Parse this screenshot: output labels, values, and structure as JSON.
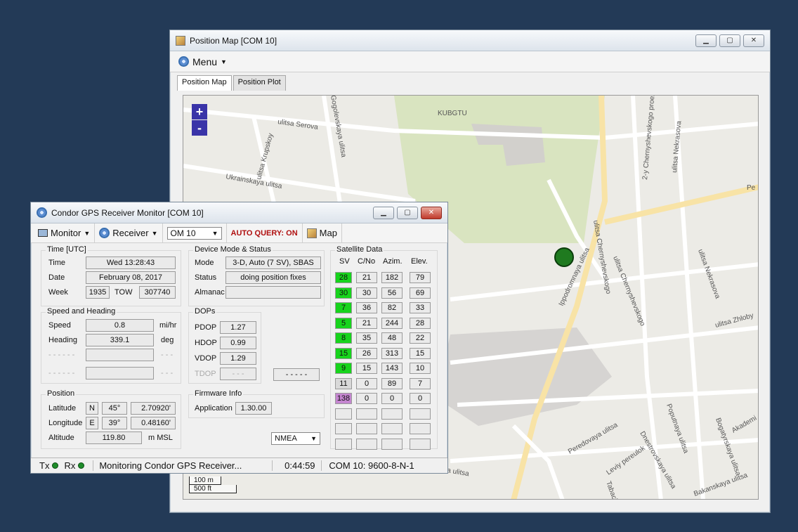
{
  "map_window": {
    "title": "Position Map [COM 10]",
    "menu_label": "Menu",
    "tabs": [
      "Position Map",
      "Position Plot"
    ],
    "zoom_in": "+",
    "zoom_out": "-",
    "scale": [
      "100 m",
      "500 ft"
    ],
    "streets": [
      "ulitsa Serova",
      "Ukrainskaya ulitsa",
      "ulitsa Krupskoy",
      "Gogolevskaya ulitsa",
      "KUBGTU",
      "ulitsa Chernyshevskogo",
      "2-y Chernyshevskogo proezd",
      "ulitsa Nekrasova",
      "Ippodromnaya ulitsa",
      "ulitsa Chernyshevskogo",
      "ulitsa Nekrasova",
      "ulitsa Zhloby",
      "Peredovaya ulitsa",
      "Leviy pereulok",
      "Dnestrovskaya ulitsa",
      "Poputnaya ulitsa",
      "Bogatyrskaya ulitsa",
      "Akademi",
      "Bakanskaya ulitsa",
      "Tabach",
      "Pe",
      "ya ulitsa"
    ]
  },
  "monitor_window": {
    "title": "Condor GPS Receiver Monitor [COM 10]",
    "toolbar": {
      "monitor": "Monitor",
      "receiver": "Receiver",
      "port": "OM 10",
      "auto_query": "AUTO QUERY: ON",
      "map": "Map"
    },
    "time": {
      "title": "Time [UTC]",
      "time_label": "Time",
      "time_value": "Wed 13:28:43",
      "date_label": "Date",
      "date_value": "February 08, 2017",
      "week_label": "Week",
      "week_value": "1935",
      "tow_label": "TOW",
      "tow_value": "307740"
    },
    "device": {
      "title": "Device Mode & Status",
      "mode_label": "Mode",
      "mode_value": "3-D, Auto (7 SV), SBAS",
      "status_label": "Status",
      "status_value": "doing position fixes",
      "almanac_label": "Almanac",
      "almanac_value": ""
    },
    "speed": {
      "title": "Speed and Heading",
      "speed_label": "Speed",
      "speed_value": "0.8",
      "speed_unit": "mi/hr",
      "heading_label": "Heading",
      "heading_value": "339.1",
      "heading_unit": "deg",
      "dash_label": "- - - - - -",
      "dash_unit": "- - -"
    },
    "dops": {
      "title": "DOPs",
      "pdop_label": "PDOP",
      "pdop_value": "1.27",
      "hdop_label": "HDOP",
      "hdop_value": "0.99",
      "vdop_label": "VDOP",
      "vdop_value": "1.29",
      "tdop_label": "TDOP",
      "tdop_value": "- - -",
      "extra_value": "- - - - -"
    },
    "position": {
      "title": "Position",
      "lat_label": "Latitude",
      "lat_hemi": "N",
      "lat_deg": "45°",
      "lat_min": "2.70920'",
      "lon_label": "Longitude",
      "lon_hemi": "E",
      "lon_deg": "39°",
      "lon_min": "0.48160'",
      "alt_label": "Altitude",
      "alt_value": "119.80",
      "alt_unit": "m MSL"
    },
    "firmware": {
      "title": "Firmware Info",
      "app_label": "Application",
      "app_value": "1.30.00"
    },
    "nmea_select": "NMEA",
    "satellites": {
      "title": "Satellite Data",
      "headers": [
        "SV",
        "C/No",
        "Azim.",
        "Elev."
      ],
      "rows": [
        {
          "sv": "28",
          "cno": "21",
          "azim": "182",
          "elev": "79",
          "color": "#17d41c"
        },
        {
          "sv": "30",
          "cno": "30",
          "azim": "56",
          "elev": "69",
          "color": "#17d41c"
        },
        {
          "sv": "7",
          "cno": "36",
          "azim": "82",
          "elev": "33",
          "color": "#17d41c"
        },
        {
          "sv": "5",
          "cno": "21",
          "azim": "244",
          "elev": "28",
          "color": "#17d41c"
        },
        {
          "sv": "8",
          "cno": "35",
          "azim": "48",
          "elev": "22",
          "color": "#17d41c"
        },
        {
          "sv": "15",
          "cno": "26",
          "azim": "313",
          "elev": "15",
          "color": "#17d41c"
        },
        {
          "sv": "9",
          "cno": "15",
          "azim": "143",
          "elev": "10",
          "color": "#17d41c"
        },
        {
          "sv": "11",
          "cno": "0",
          "azim": "89",
          "elev": "7",
          "color": "#d9d9d9"
        },
        {
          "sv": "138",
          "cno": "0",
          "azim": "0",
          "elev": "0",
          "color": "#c586d0"
        }
      ]
    },
    "statusbar": {
      "tx": "Tx",
      "rx": "Rx",
      "message": "Monitoring Condor GPS Receiver...",
      "elapsed": "0:44:59",
      "port": "COM 10: 9600-8-N-1"
    }
  }
}
